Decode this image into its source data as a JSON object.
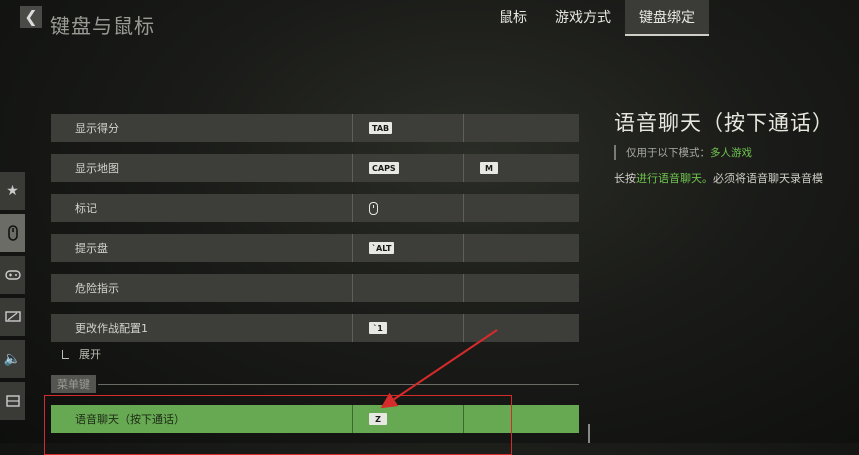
{
  "header": {
    "back_icon": "chevron-left-icon",
    "title": "键盘与鼠标",
    "tabs": [
      {
        "label": "鼠标",
        "active": false
      },
      {
        "label": "游戏方式",
        "active": false
      },
      {
        "label": "键盘绑定",
        "active": true
      }
    ]
  },
  "sidebar": {
    "items": [
      {
        "icon": "star-icon",
        "active": false
      },
      {
        "icon": "mouse-icon",
        "active": true
      },
      {
        "icon": "gamepad-icon",
        "active": false
      },
      {
        "icon": "monitor-icon",
        "active": false
      },
      {
        "icon": "speaker-icon",
        "active": false
      },
      {
        "icon": "interface-icon",
        "active": false
      }
    ]
  },
  "bindings": [
    {
      "label": "显示得分",
      "key1": "TAB",
      "key2": ""
    },
    {
      "label": "显示地图",
      "key1": "CAPS",
      "key2": "M"
    },
    {
      "label": "标记",
      "key1": "mouse-middle-icon",
      "key2": ""
    },
    {
      "label": "提示盘",
      "key1": "`ALT",
      "key2": ""
    },
    {
      "label": "危险指示",
      "key1": "",
      "key2": ""
    },
    {
      "label": "更改作战配置1",
      "key1": "`1",
      "key2": ""
    }
  ],
  "expand_label": "展开",
  "section_label": "菜单键",
  "selected_row": {
    "label": "语音聊天（按下通话）",
    "key1": "Z",
    "key2": ""
  },
  "detail": {
    "title": "语音聊天（按下通话）",
    "modes_prefix": "仅用于以下模式：",
    "modes_value": "多人游戏",
    "desc_prefix": "长按",
    "desc_highlight": "进行语音聊天。",
    "desc_suffix": "必须将语音聊天录音模"
  },
  "colors": {
    "accent_green": "#67a852",
    "highlight_text": "#6fc44f",
    "annotation_red": "#d62b2b"
  }
}
